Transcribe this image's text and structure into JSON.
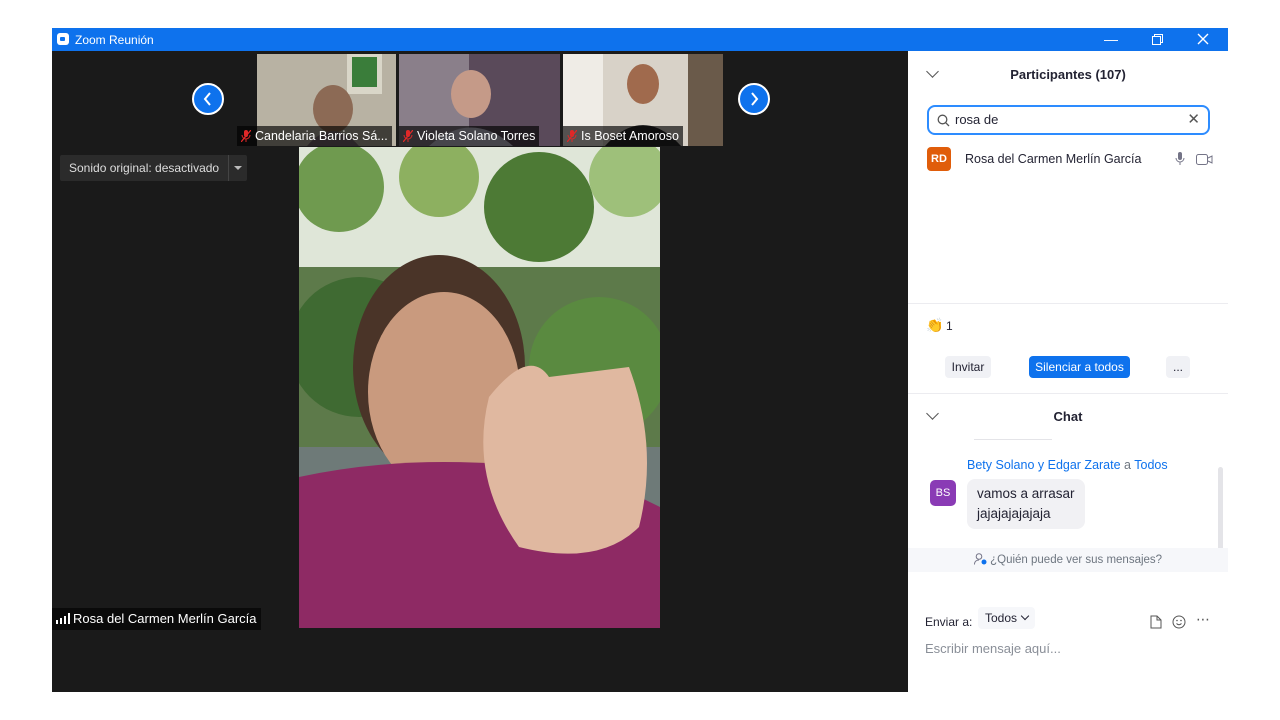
{
  "window": {
    "title": "Zoom Reunión"
  },
  "thumbnails": [
    {
      "name": "Candelaria Barrios Sá..."
    },
    {
      "name": "Violeta Solano Torres"
    },
    {
      "name": "Is Boset Amoroso"
    }
  ],
  "original_sound": {
    "label": "Sonido original: desactivado"
  },
  "speaker": {
    "name": "Rosa del Carmen Merlín García"
  },
  "participants": {
    "title": "Participantes (107)",
    "search_value": "rosa de",
    "results": [
      {
        "initials": "RD",
        "name": "Rosa del Carmen Merlín García",
        "avatar_color": "#e05d0a"
      }
    ],
    "reaction": {
      "emoji": "👏",
      "count": "1"
    },
    "invite_label": "Invitar",
    "mute_all_label": "Silenciar a todos",
    "more_label": "..."
  },
  "chat": {
    "title": "Chat",
    "messages": [
      {
        "initials": "BS",
        "avatar_color": "#8a3bb5",
        "sender": "Bety Solano y Edgar Zarate",
        "recipient": "Todos",
        "to_word": "a",
        "lines": [
          "vamos a arrasar",
          "jajajajajajaja"
        ]
      }
    ],
    "who_can_see": "¿Quién puede ver sus mensajes?",
    "send_to_label": "Enviar a:",
    "send_to_value": "Todos",
    "input_placeholder": "Escribir mensaje aquí..."
  },
  "colors": {
    "accent": "#0e72ed",
    "titlebar": "#0e72ed",
    "stage_bg": "#1a1a1a"
  }
}
